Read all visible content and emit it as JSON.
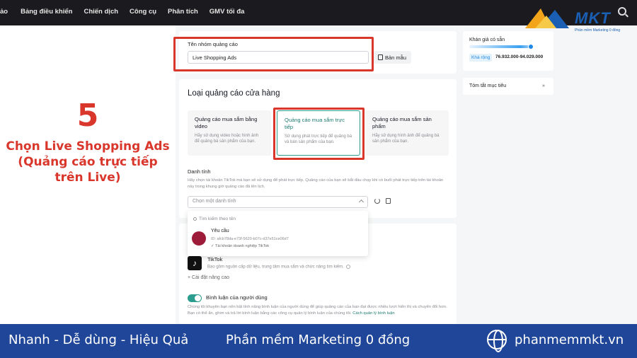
{
  "topnav": [
    "ảo",
    "Bảng điều khiển",
    "Chiến dịch",
    "Công cụ",
    "Phân tích",
    "GMV tối đa"
  ],
  "logo": {
    "text": "MKT",
    "sub": "Phần mềm Marketing 0 đồng"
  },
  "step": {
    "number": "5",
    "description": "Chọn Live Shopping Ads (Quảng cáo trực tiếp trên Live)"
  },
  "adgroup": {
    "label": "Tên nhóm quảng cáo",
    "value": "Live Shopping Ads",
    "template_button": "Bản mẫu"
  },
  "store_ads": {
    "title": "Loại quảng cáo cửa hàng",
    "options": [
      {
        "title": "Quảng cáo mua sắm bằng video",
        "desc": "Hãy sử dụng video hoặc hình ảnh để quảng bá sản phẩm của bạn."
      },
      {
        "title": "Quảng cáo mua sắm trực tiếp",
        "desc": "Sử dụng phát trực tiếp để quảng bá và bán sản phẩm của bạn."
      },
      {
        "title": "Quảng cáo mua sắm sản phẩm",
        "desc": "Hãy sử dụng hình ảnh để quảng bá sản phẩm của bạn."
      }
    ]
  },
  "identity": {
    "label": "Danh tính",
    "desc": "Hãy chọn tài khoản TikTok mà bạn sẽ sử dụng để phát trực tiếp. Quảng cáo của bạn sẽ bắt đầu chạy khi có buổi phát trực tiếp trên tài khoản này trong khung giờ quảng cáo đã lên lịch.",
    "placeholder": "Chọn một danh tính",
    "search_placeholder": "Tìm kiếm theo tên",
    "account": {
      "name": "Yêu cầu",
      "id": "ID: afcb78da-e73f-5620-b07c-d37e51ce06d7",
      "type": "Tài khoản doanh nghiệp TikTok"
    }
  },
  "tiktok": {
    "icon": "tiktok-icon",
    "name": "TikTok",
    "desc": "Bao gồm nguồn cấp dữ liệu, trung tâm mua sắm và chức năng tìm kiếm.",
    "advanced": "Cài đặt nâng cao"
  },
  "comments": {
    "label": "Bình luận của người dùng",
    "desc": "Chúng tôi khuyên bạn nên bật tính năng bình luận của người dùng để giúp quảng cáo của bạn đạt được nhiều lượt hiển thị và chuyển đổi hơn. Bạn có thể ẩn, ghim và trả lời bình luận bằng các công cụ quản lý bình luận của chúng tôi.",
    "link": "Cách quản lý bình luận"
  },
  "sidebar": {
    "estimate_title": "Khán giả có sẵn",
    "badge": "Khá rộng",
    "range": "76.932.000-94.029.000",
    "summary": "Tóm tắt mục tiêu"
  },
  "footer": {
    "left": "Nhanh - Dễ dùng - Hiệu Quả",
    "middle": "Phần mềm Marketing 0 đồng",
    "right": "phanmemmkt.vn"
  }
}
